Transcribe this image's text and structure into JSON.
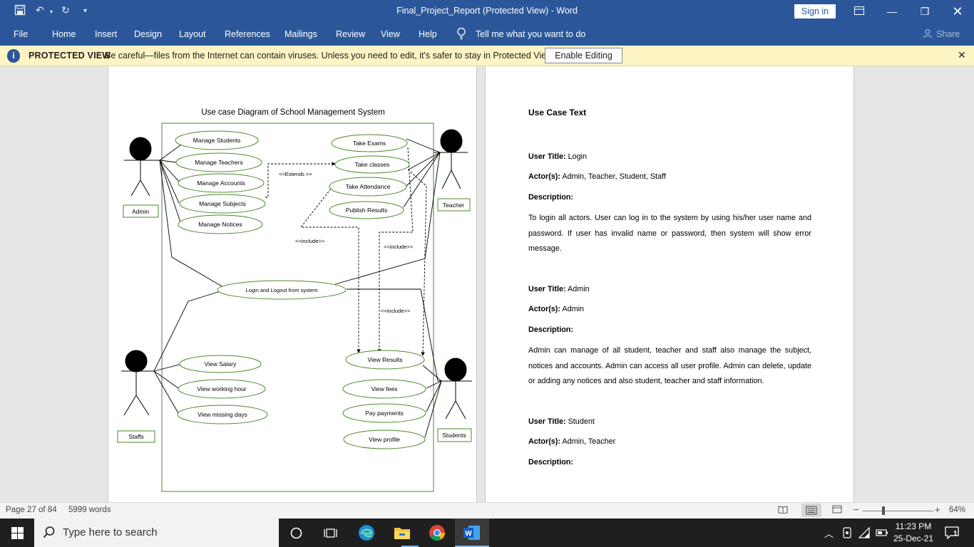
{
  "window": {
    "title": "Final_Project_Report (Protected View)  -  Word",
    "signin": "Sign in",
    "share": "Share"
  },
  "ribbon": {
    "tabs": [
      "File",
      "Home",
      "Insert",
      "Design",
      "Layout",
      "References",
      "Mailings",
      "Review",
      "View",
      "Help"
    ],
    "tell_me": "Tell me what you want to do"
  },
  "protected_view": {
    "label": "PROTECTED VIEW",
    "message": "Be careful—files from the Internet can contain viruses. Unless you need to edit, it's safer to stay in Protected View.",
    "button": "Enable Editing"
  },
  "diagram": {
    "title": "Use case Diagram of School Management System",
    "actors": [
      "Admin",
      "Teacher",
      "Staffs",
      "Students"
    ],
    "usecases": {
      "admin": [
        "Manage Students",
        "Manage Teachers",
        "Manage Accounts",
        "Manage Subjects",
        "Manage Notices"
      ],
      "teacher": [
        "Take Exams",
        "Take classes",
        "Take Attendance",
        "Publish Results"
      ],
      "login": "Login and Logout from system",
      "staff": [
        "View Salary",
        "View working hour",
        "View missing days"
      ],
      "student": [
        "View Results",
        "View fees",
        "Pay payments",
        "View profile"
      ]
    },
    "relations": {
      "extends": "<<Extends >>",
      "include1": "<<include>>",
      "include2": "<<include>>",
      "include3": "<<include>>"
    }
  },
  "page2": {
    "heading": "Use Case Text",
    "sections": [
      {
        "title_label": "User Title:",
        "title": "Login",
        "actors_label": "Actor(s):",
        "actors": "Admin, Teacher, Student, Staff",
        "desc_label": "Description:",
        "desc": "To login all actors. User can log in to the system by using his/her user name and password. If user has invalid name or password, then system will show error message."
      },
      {
        "title_label": "User Title:",
        "title": "Admin",
        "actors_label": "Actor(s):",
        "actors": " Admin",
        "desc_label": "Description:",
        "desc": "Admin can manage of all student, teacher and staff also manage the subject, notices and accounts. Admin can access all user profile. Admin can delete, update or adding any notices and also student, teacher and staff information."
      },
      {
        "title_label": "User Title:",
        "title": "Student",
        "actors_label": "Actor(s):",
        "actors": "Admin, Teacher",
        "desc_label": "Description:"
      }
    ]
  },
  "status": {
    "page": "Page 27 of 84",
    "words": "5999 words",
    "zoom": "64%"
  },
  "taskbar": {
    "search": "Type here to search",
    "time": "11:23 PM",
    "date": "25-Dec-21",
    "notifications": "1"
  },
  "colors": {
    "word_blue": "#2b579a",
    "pv_yellow": "#fcf4c3",
    "diagram_green": "#4a8a2a"
  }
}
